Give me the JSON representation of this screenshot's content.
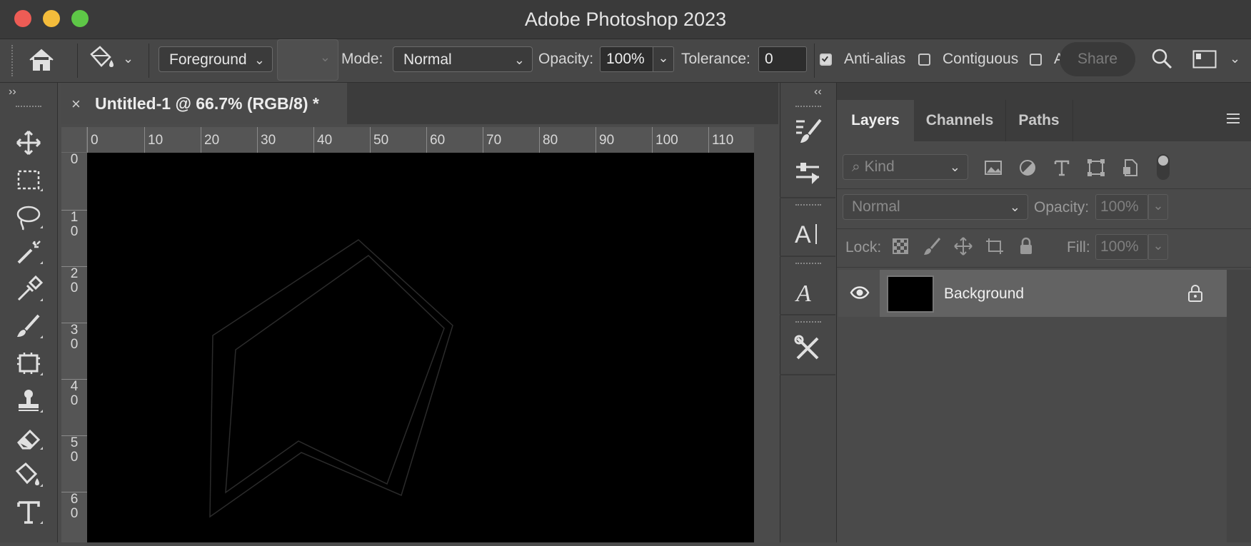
{
  "window": {
    "title": "Adobe Photoshop 2023"
  },
  "traffic_lights": {
    "close": "#ed5c55",
    "minimize": "#f4bc3b",
    "zoom": "#5ec747"
  },
  "options_bar": {
    "fill_source": "Foreground",
    "mode_label": "Mode:",
    "mode_value": "Normal",
    "opacity_label": "Opacity:",
    "opacity_value": "100%",
    "tolerance_label": "Tolerance:",
    "tolerance_value": "0",
    "anti_alias_label": "Anti-alias",
    "anti_alias_checked": true,
    "contiguous_label": "Contiguous",
    "contiguous_checked": false,
    "all_layers_checked": false,
    "share_label": "Share"
  },
  "document": {
    "tab_title": "Untitled-1 @ 66.7% (RGB/8) *",
    "close_glyph": "×",
    "canvas_color": "#000000",
    "h_ruler": [
      "0",
      "10",
      "20",
      "30",
      "40",
      "50",
      "60",
      "70",
      "80",
      "90",
      "100",
      "110"
    ],
    "v_ruler": [
      "0",
      "1\n0",
      "2\n0",
      "3\n0",
      "4\n0",
      "5\n0",
      "6\n0"
    ]
  },
  "tools": [
    "move-icon",
    "rectangular-marquee-icon",
    "lasso-icon",
    "magic-wand-icon",
    "eyedropper-icon",
    "brush-icon",
    "frame-icon",
    "stamp-icon",
    "eraser-icon",
    "paint-bucket-icon",
    "type-icon"
  ],
  "panel_strip": [
    "brush-settings-icon",
    "adjustments-icon",
    "character-icon",
    "glyphs-icon",
    "tool-presets-icon"
  ],
  "layers_panel": {
    "tabs": [
      "Layers",
      "Channels",
      "Paths"
    ],
    "active_tab": "Layers",
    "filter_placeholder": "Kind",
    "blend_mode": "Normal",
    "opacity_label": "Opacity:",
    "opacity_value": "100%",
    "lock_label": "Lock:",
    "fill_label": "Fill:",
    "fill_value": "100%",
    "layers": [
      {
        "name": "Background",
        "visible": true,
        "locked": true
      }
    ]
  }
}
